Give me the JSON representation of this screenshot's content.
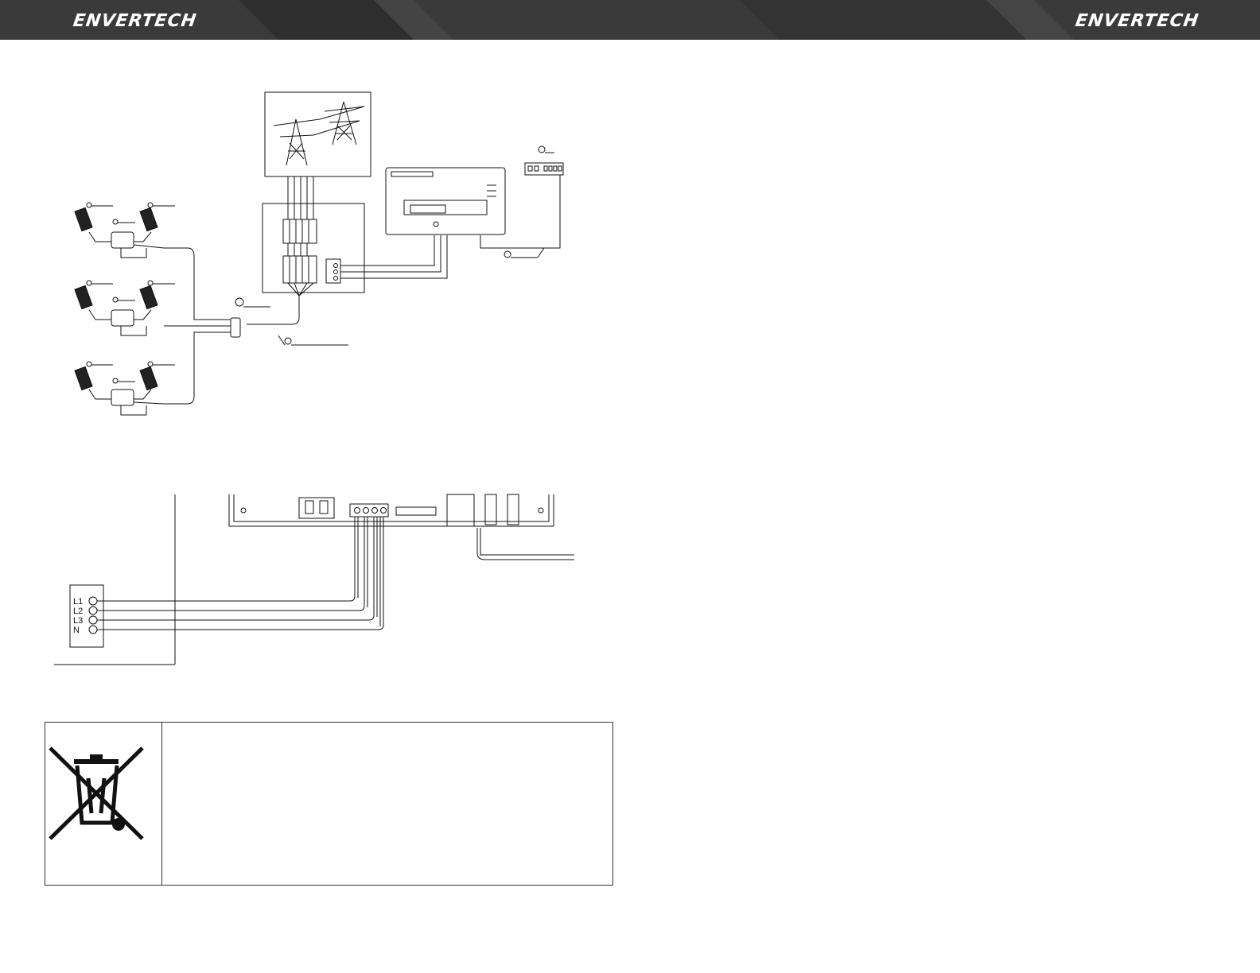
{
  "header": {
    "brand_left": "ENVERTECH",
    "brand_right": "ENVERTECH",
    "background_color": "#3b3b3b",
    "text_color": "#ffffff"
  },
  "wiring_diagram": {
    "terminals": [
      "L1",
      "L2",
      "L3",
      "N"
    ]
  },
  "disposal_notice": {
    "icon": "crossed-out-wheelie-bin-icon"
  }
}
